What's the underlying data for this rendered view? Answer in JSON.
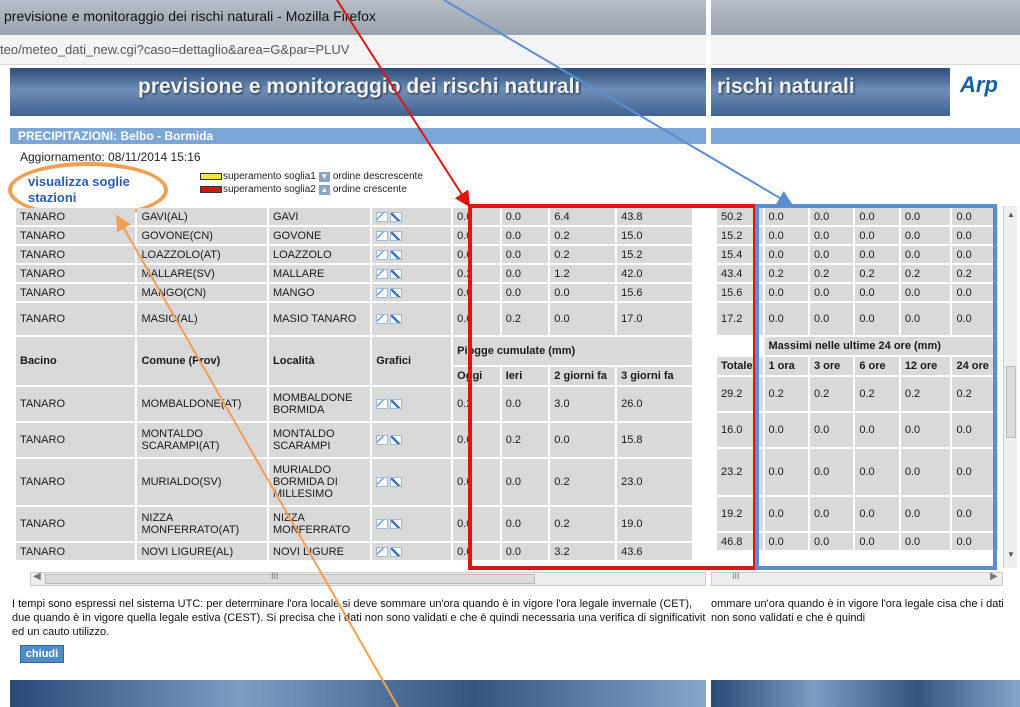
{
  "window": {
    "title": "previsione e monitoraggio dei rischi naturali - Mozilla Firefox",
    "url": "teo/meteo_dati_new.cgi?caso=dettaglio&area=G&par=PLUV"
  },
  "banner": {
    "title_left": "previsione e monitoraggio dei rischi naturali",
    "title_right": "rischi naturali",
    "logo": "Arp"
  },
  "section_title": "PRECIPITAZIONI: Belbo - Bormida",
  "updated": "Aggiornamento: 08/11/2014 15:16",
  "legend": {
    "threshold1": "superamento soglia1",
    "order_desc": "ordine descrescente",
    "threshold2": "superamento soglia2",
    "order_asc": "ordine crescente"
  },
  "soglie_link": "visualizza soglie stazioni",
  "headers": {
    "bacino": "Bacino",
    "comune": "Comune (Prov)",
    "localita": "Località",
    "grafici": "Grafici",
    "piogge": "Piogge cumulate (mm)",
    "oggi": "Oggi",
    "ieri": "Ieri",
    "due_giorni": "2 giorni fa",
    "tre_giorni": "3 giorni fa",
    "massimi": "Massimi nelle ultime 24 ore (mm)",
    "totale": "Totale",
    "ora1": "1 ora",
    "ore3": "3 ore",
    "ore6": "6 ore",
    "ore12": "12 ore",
    "ore24": "24 ore"
  },
  "rows_top": [
    {
      "bacino": "TANARO",
      "comune": "GAVI(AL)",
      "localita": "GAVI",
      "oggi": "0.0",
      "ieri": "0.0",
      "g2": "6.4",
      "g3": "43.8",
      "tot": "50.2",
      "h1": "0.0",
      "h3": "0.0",
      "h6": "0.0",
      "h12": "0.0",
      "h24": "0.0"
    },
    {
      "bacino": "TANARO",
      "comune": "GOVONE(CN)",
      "localita": "GOVONE",
      "oggi": "0.0",
      "ieri": "0.0",
      "g2": "0.2",
      "g3": "15.0",
      "tot": "15.2",
      "h1": "0.0",
      "h3": "0.0",
      "h6": "0.0",
      "h12": "0.0",
      "h24": "0.0"
    },
    {
      "bacino": "TANARO",
      "comune": "LOAZZOLO(AT)",
      "localita": "LOAZZOLO",
      "oggi": "0.0",
      "ieri": "0.0",
      "g2": "0.2",
      "g3": "15.2",
      "tot": "15.4",
      "h1": "0.0",
      "h3": "0.0",
      "h6": "0.0",
      "h12": "0.0",
      "h24": "0.0"
    },
    {
      "bacino": "TANARO",
      "comune": "MALLARE(SV)",
      "localita": "MALLARE",
      "oggi": "0.2",
      "ieri": "0.0",
      "g2": "1.2",
      "g3": "42.0",
      "tot": "43.4",
      "h1": "0.2",
      "h3": "0.2",
      "h6": "0.2",
      "h12": "0.2",
      "h24": "0.2"
    },
    {
      "bacino": "TANARO",
      "comune": "MANGO(CN)",
      "localita": "MANGO",
      "oggi": "0.0",
      "ieri": "0.0",
      "g2": "0.0",
      "g3": "15.6",
      "tot": "15.6",
      "h1": "0.0",
      "h3": "0.0",
      "h6": "0.0",
      "h12": "0.0",
      "h24": "0.0"
    },
    {
      "bacino": "TANARO",
      "comune": "MASIO(AL)",
      "localita": "MASIO TANARO",
      "oggi": "0.0",
      "ieri": "0.2",
      "g2": "0.0",
      "g3": "17.0",
      "tot": "17.2",
      "h1": "0.0",
      "h3": "0.0",
      "h6": "0.0",
      "h12": "0.0",
      "h24": "0.0"
    }
  ],
  "rows_bottom": [
    {
      "bacino": "TANARO",
      "comune": "MOMBALDONE(AT)",
      "localita": "MOMBALDONE BORMIDA",
      "oggi": "0.2",
      "ieri": "0.0",
      "g2": "3.0",
      "g3": "26.0",
      "tot": "29.2",
      "h1": "0.2",
      "h3": "0.2",
      "h6": "0.2",
      "h12": "0.2",
      "h24": "0.2"
    },
    {
      "bacino": "TANARO",
      "comune": "MONTALDO SCARAMPI(AT)",
      "localita": "MONTALDO SCARAMPI",
      "oggi": "0.0",
      "ieri": "0.2",
      "g2": "0.0",
      "g3": "15.8",
      "tot": "16.0",
      "h1": "0.0",
      "h3": "0.0",
      "h6": "0.0",
      "h12": "0.0",
      "h24": "0.0"
    },
    {
      "bacino": "TANARO",
      "comune": "MURIALDO(SV)",
      "localita": "MURIALDO BORMIDA DI MILLESIMO",
      "oggi": "0.0",
      "ieri": "0.0",
      "g2": "0.2",
      "g3": "23.0",
      "tot": "23.2",
      "h1": "0.0",
      "h3": "0.0",
      "h6": "0.0",
      "h12": "0.0",
      "h24": "0.0"
    },
    {
      "bacino": "TANARO",
      "comune": "NIZZA MONFERRATO(AT)",
      "localita": "NIZZA MONFERRATO",
      "oggi": "0.0",
      "ieri": "0.0",
      "g2": "0.2",
      "g3": "19.0",
      "tot": "19.2",
      "h1": "0.0",
      "h3": "0.0",
      "h6": "0.0",
      "h12": "0.0",
      "h24": "0.0"
    },
    {
      "bacino": "TANARO",
      "comune": "NOVI LIGURE(AL)",
      "localita": "NOVI LIGURE",
      "oggi": "0.0",
      "ieri": "0.0",
      "g2": "3.2",
      "g3": "43.6",
      "tot": "46.8",
      "h1": "0.0",
      "h3": "0.0",
      "h6": "0.0",
      "h12": "0.0",
      "h24": "0.0"
    }
  ],
  "footnote_left": "I tempi sono espressi nel sistema UTC: per determinare l'ora locale si deve sommare un'ora quando è in vigore l'ora legale invernale (CET), due quando è in vigore quella legale estiva (CEST). Si precisa che i dati non sono validati e che è quindi necessaria una verifica di significatività ed un cauto utilizzo.",
  "footnote_right": "ommare un'ora quando è in vigore l'ora legale cisa che i dati non sono validati e che è quindi",
  "close_label": "chiudi",
  "colors": {
    "highlight_red": "#e01414",
    "highlight_blue": "#5b8ed0",
    "annotation_orange": "#f0a050",
    "section_bg": "#7ba6d6",
    "cell_bg": "#d9d9d9"
  }
}
